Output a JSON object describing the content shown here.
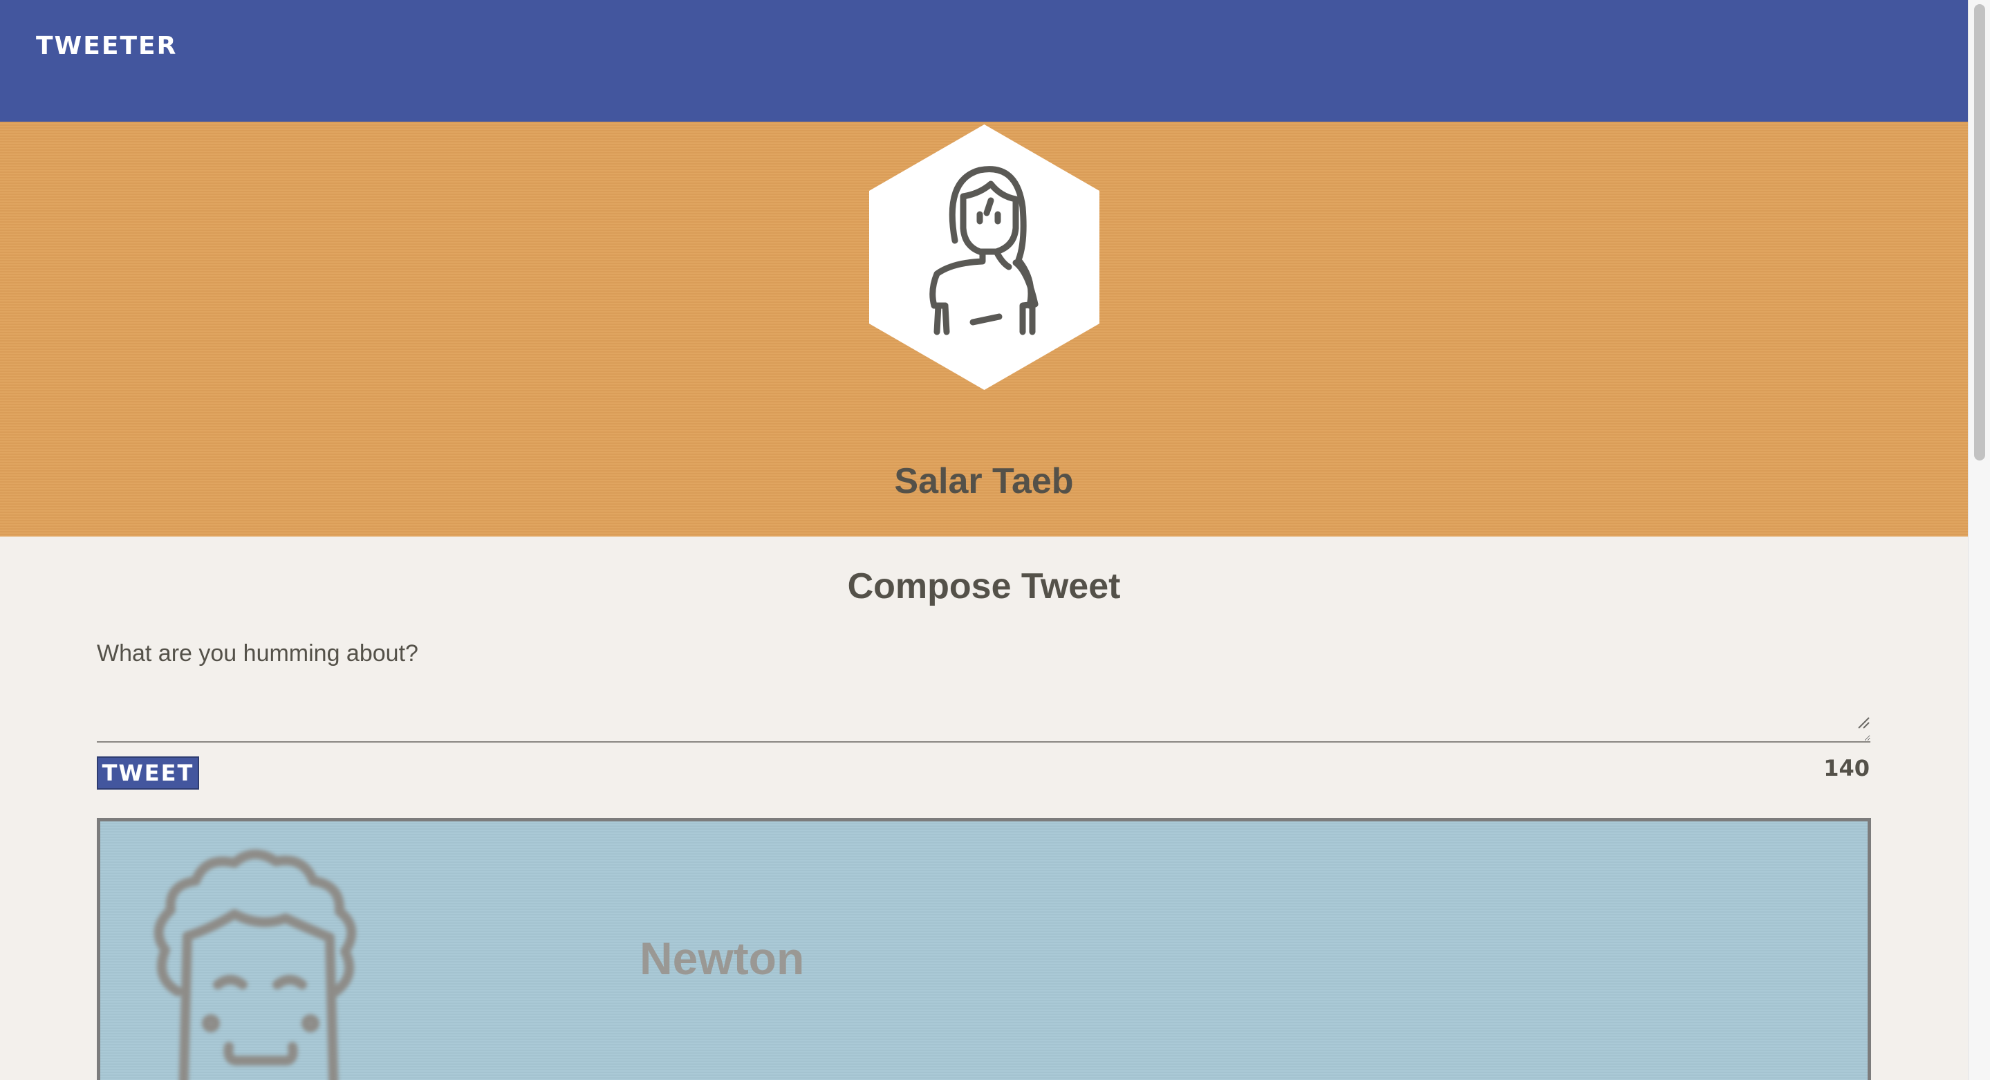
{
  "nav": {
    "brand": "TWEETER",
    "color": "#43569e"
  },
  "profile": {
    "name": "Salar Taeb",
    "avatar_icon": "woman-avatar-icon",
    "header_color": "#dfa15a"
  },
  "compose": {
    "title": "Compose Tweet",
    "placeholder": "What are you humming about?",
    "button_label": "TWEET",
    "counter": "140"
  },
  "tweets": [
    {
      "author": "Newton",
      "avatar_icon": "curly-hair-man-avatar-icon",
      "card_color": "#a7c7d4"
    }
  ]
}
